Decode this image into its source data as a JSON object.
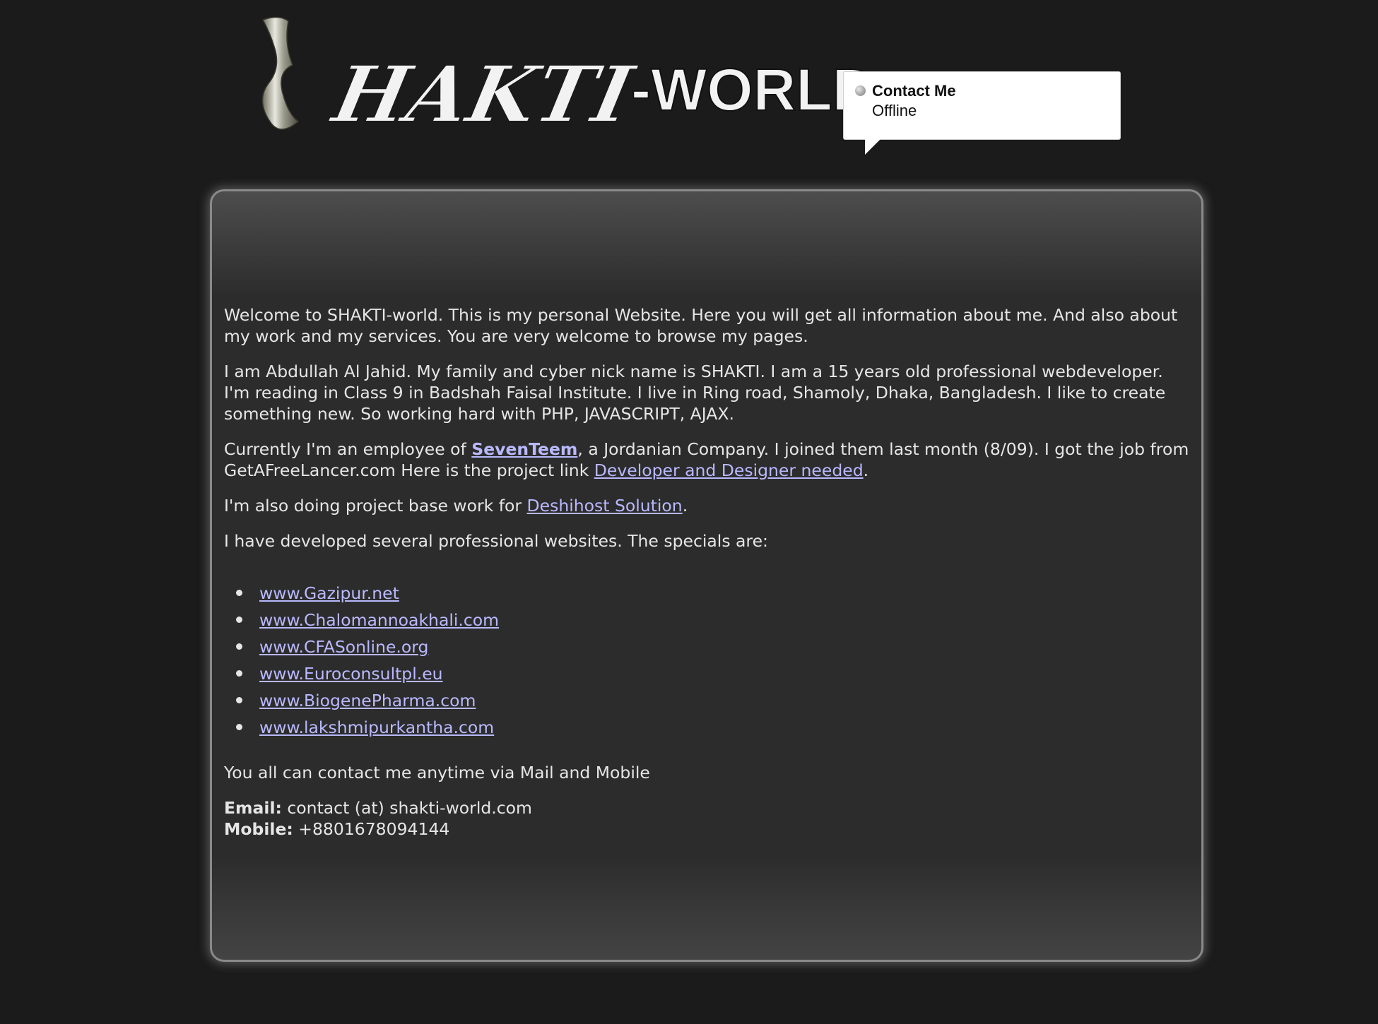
{
  "header": {
    "logo_text": "HAKTI-WORLD",
    "logo_text_left": "HAKTI",
    "logo_text_right": "-WORLD",
    "logo_icon": "steel-s-icon"
  },
  "contact_widget": {
    "title": "Contact Me",
    "status": "Offline",
    "status_icon": "status-dot-icon",
    "status_color": "#a9a9a9"
  },
  "content": {
    "welcome": "Welcome to SHAKTI-world. This is my personal Website. Here you will get all information about me. And also about my work and my services. You are very welcome to browse my pages.",
    "about": "I am Abdullah Al Jahid. My family and cyber nick name is SHAKTI. I am a 15 years old professional webdeveloper. I'm reading in Class 9 in Badshah Faisal Institute. I live in Ring road, Shamoly, Dhaka, Bangladesh. I like to create something new. So working hard with PHP, JAVASCRIPT, AJAX.",
    "employment": {
      "prefix": "Currently I'm an employee of ",
      "company_link": "SevenTeem",
      "middle": ", a Jordanian Company. I joined them last month (8/09). I got the job from GetAFreeLancer.com Here is the project link ",
      "project_link": "Developer and Designer needed",
      "suffix": "."
    },
    "project_work": {
      "prefix": "I'm also doing project base work for ",
      "link": "Deshihost Solution",
      "suffix": "."
    },
    "sites_intro": "I have developed several professional websites. The specials are:",
    "sites": [
      "www.Gazipur.net",
      "www.Chalomannoakhali.com",
      "www.CFASonline.org",
      "www.Euroconsultpl.eu",
      "www.BiogenePharma.com",
      "www.lakshmipurkantha.com"
    ],
    "contact_intro": "You all can contact me anytime via Mail and Mobile",
    "email_label": "Email:",
    "email_value": " contact (at) shakti-world.com",
    "mobile_label": "Mobile:",
    "mobile_value": " +8801678094144"
  },
  "colors": {
    "background": "#1b1b1b",
    "panel": "#2c2c2c",
    "text": "#e6e6e6",
    "link": "#b9b9ff"
  }
}
